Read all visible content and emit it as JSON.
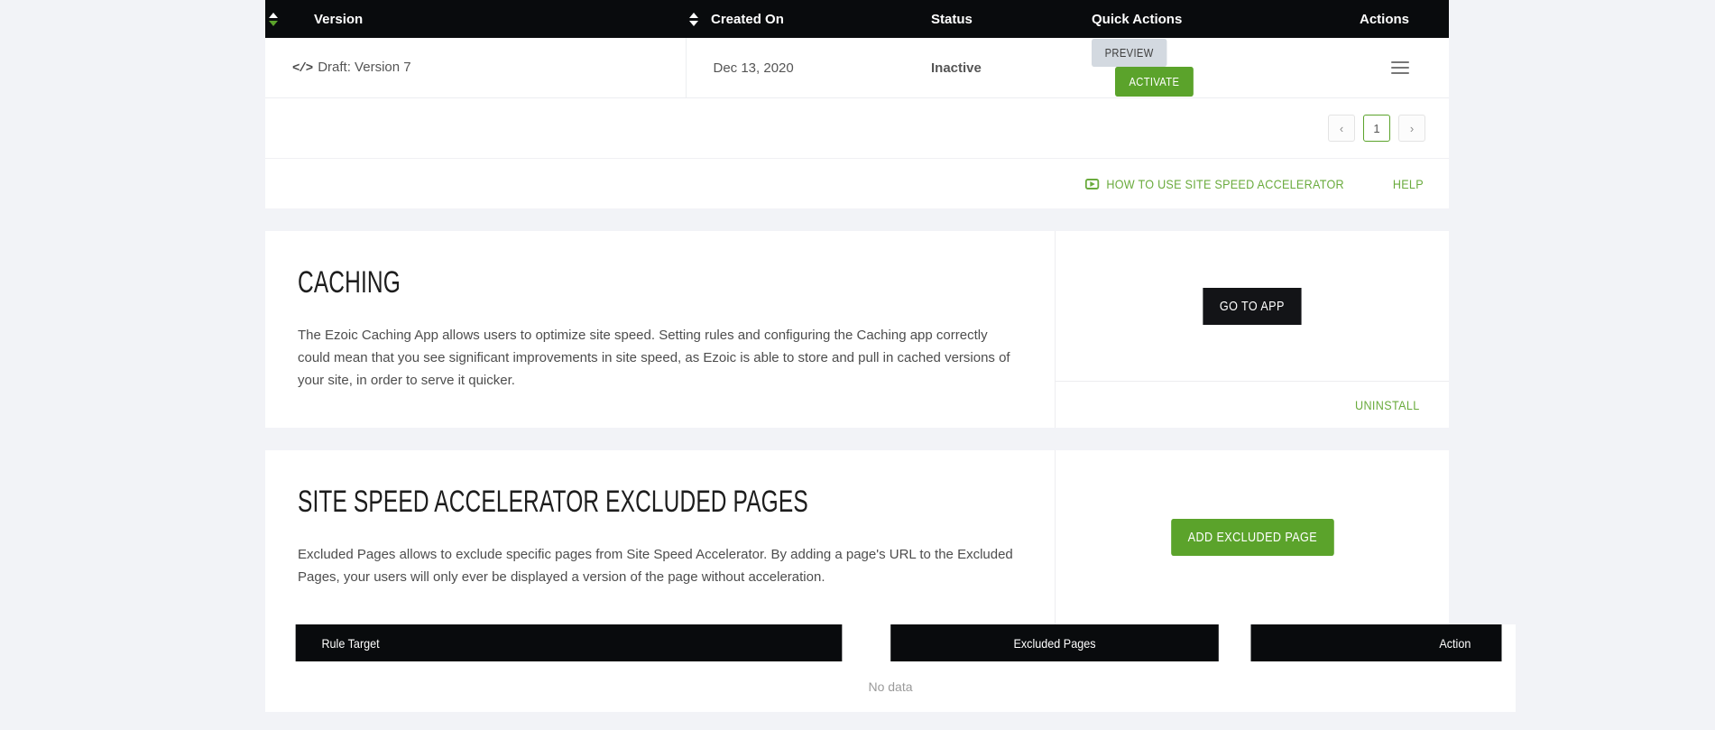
{
  "theme": {
    "page_bg": "#f2f3f7",
    "accent_green": "#5ba32b",
    "link_green": "#6aab3d",
    "header_black": "#090b0d",
    "preview_gray": "#d3d9e0"
  },
  "versions_table": {
    "columns": [
      {
        "key": "version",
        "label": "Version",
        "sortable": true,
        "sort_state": "asc"
      },
      {
        "key": "created_on",
        "label": "Created On",
        "sortable": true,
        "sort_state": "none"
      },
      {
        "key": "status",
        "label": "Status",
        "sortable": false
      },
      {
        "key": "quick_actions",
        "label": "Quick Actions",
        "sortable": false
      },
      {
        "key": "actions",
        "label": "Actions",
        "sortable": false
      }
    ],
    "rows": [
      {
        "version_icon": "code-icon",
        "version": "Draft: Version 7",
        "created_on": "Dec 13, 2020",
        "status": "Inactive",
        "preview_label": "PREVIEW",
        "activate_label": "ACTIVATE",
        "row_menu_icon": "hamburger-icon"
      }
    ]
  },
  "pagination": {
    "prev_label": "‹",
    "next_label": "›",
    "pages": [
      "1"
    ],
    "current_page": "1"
  },
  "help_bar": {
    "video_icon": "video-play-icon",
    "tutorial_label": "HOW TO USE SITE SPEED ACCELERATOR",
    "help_label": "HELP"
  },
  "caching_panel": {
    "title": "CACHING",
    "body": "The Ezoic Caching App allows users to optimize site speed. Setting rules and configuring the Caching app correctly could mean that you see significant improvements in site speed, as Ezoic is able to store and pull in cached versions of your site, in order to serve it quicker.",
    "primary_button": "GO TO APP",
    "uninstall_label": "UNINSTALL"
  },
  "excluded_pages_panel": {
    "title": "SITE SPEED ACCELERATOR EXCLUDED PAGES",
    "body": "Excluded Pages allows to exclude specific pages from Site Speed Accelerator. By adding a page's URL to the Excluded Pages, your users will only ever be displayed a version of the page without acceleration.",
    "primary_button": "ADD EXCLUDED PAGE"
  },
  "excluded_pages_table": {
    "columns": [
      {
        "key": "rule_target",
        "label": "Rule Target"
      },
      {
        "key": "excluded_pages",
        "label": "Excluded Pages"
      },
      {
        "key": "action",
        "label": "Action"
      }
    ],
    "empty_text": "No data"
  }
}
